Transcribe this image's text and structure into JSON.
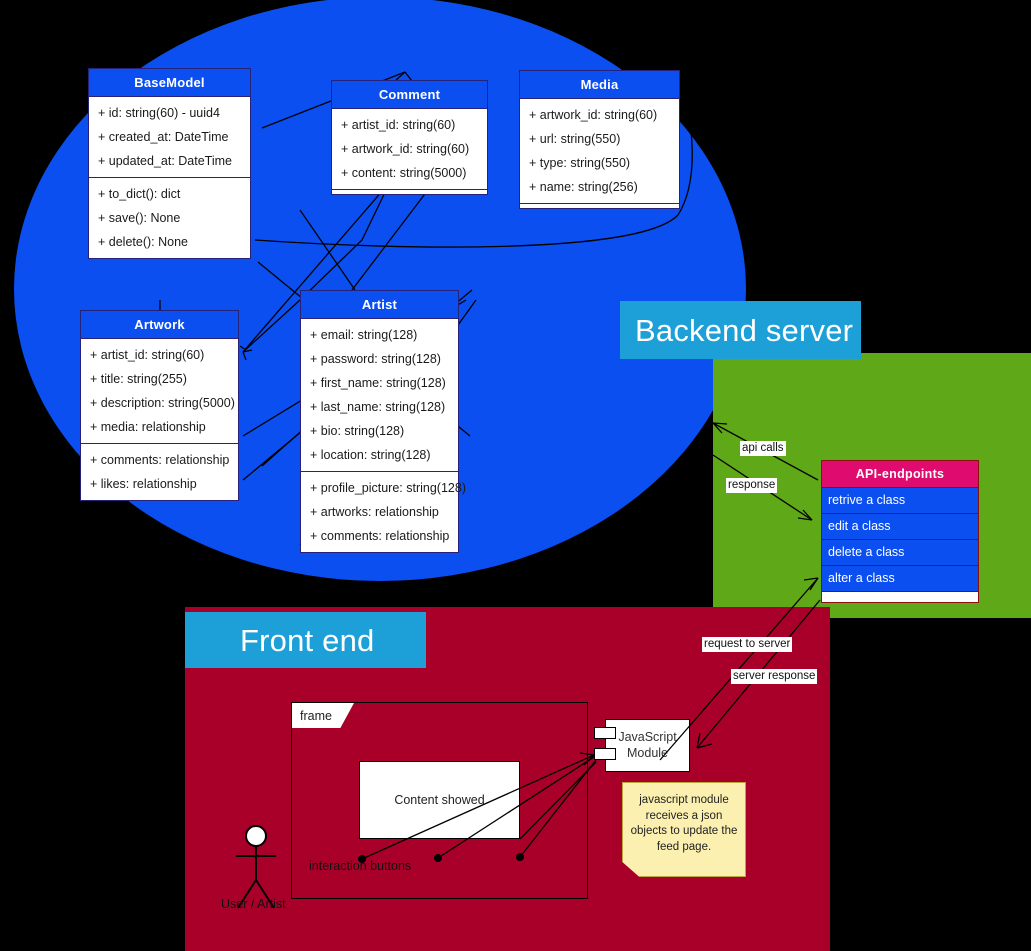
{
  "regions": {
    "backend": {
      "label": "Backend server",
      "color": "#5fa919",
      "header_color": "#1d9fd8"
    },
    "frontend": {
      "label": "Front end",
      "color": "#a80028",
      "header_color": "#1d9fd8"
    },
    "database": {
      "color": "#0b4ff0"
    }
  },
  "classes": [
    {
      "name": "BaseModel",
      "attributes": [
        "+ id: string(60) - uuid4",
        "+ created_at: DateTime",
        "+ updated_at: DateTime"
      ],
      "methods": [
        "+ to_dict(): dict",
        "+ save(): None",
        "+ delete(): None"
      ]
    },
    {
      "name": "Comment",
      "attributes": [
        "+ artist_id: string(60)",
        "+ artwork_id: string(60)",
        "+ content: string(5000)"
      ],
      "methods": []
    },
    {
      "name": "Media",
      "attributes": [
        "+ artwork_id: string(60)",
        "+ url: string(550)",
        "+ type: string(550)",
        "+ name: string(256)"
      ],
      "methods": []
    },
    {
      "name": "Artwork",
      "attributes": [
        "+ artist_id: string(60)",
        "+ title: string(255)",
        "+ description: string(5000)",
        "+ media: relationship"
      ],
      "methods": [
        "+ comments: relationship",
        "+ likes: relationship"
      ]
    },
    {
      "name": "Artist",
      "attributes": [
        "+ email: string(128)",
        "+ password: string(128)",
        "+ first_name: string(128)",
        "+ last_name: string(128)",
        "+ bio: string(128)",
        "+ location: string(128)"
      ],
      "methods": [
        "+ profile_picture: string(128)",
        "+ artworks: relationship",
        "+ comments: relationship"
      ]
    }
  ],
  "api_table": {
    "title": "API-endpoints",
    "header_color": "#e00b6e",
    "row_color": "#0b4ff0",
    "rows": [
      "retrive a class",
      "edit a class",
      "delete a class",
      "alter a class"
    ]
  },
  "edge_labels": {
    "api_calls": "api calls",
    "response": "response",
    "request_to_server": "request to server",
    "server_response": "server response"
  },
  "frontend": {
    "frame_tab": "frame",
    "content_box": "Content showed",
    "interaction_buttons": "interaction buttons",
    "actor_label": "User / Artist",
    "js_module_line1": "JavaScript",
    "js_module_line2": "Module",
    "note": "javascript module receives a json objects to update the feed page."
  }
}
